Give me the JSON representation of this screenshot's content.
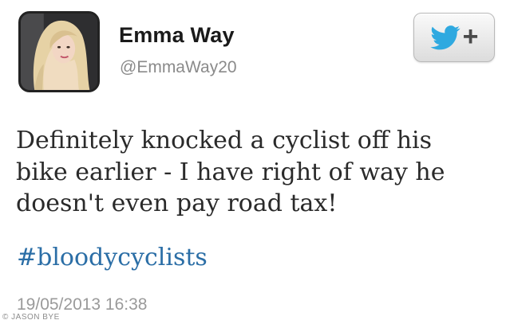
{
  "author": {
    "display_name": "Emma Way",
    "handle": "@EmmaWay20",
    "avatar": "profile-photo"
  },
  "follow_button": {
    "icon": "twitter-bird-icon",
    "plus": "+",
    "bird_color": "#2fa9e0"
  },
  "tweet": {
    "text": "Definitely knocked a cyclist off his\nbike earlier - I have right of way he\ndoesn't even pay road tax!",
    "hashtag": "#bloodycyclists",
    "hashtag_color": "#2b6ea6",
    "timestamp": "19/05/2013 16:38"
  },
  "credit": "© JASON BYE"
}
